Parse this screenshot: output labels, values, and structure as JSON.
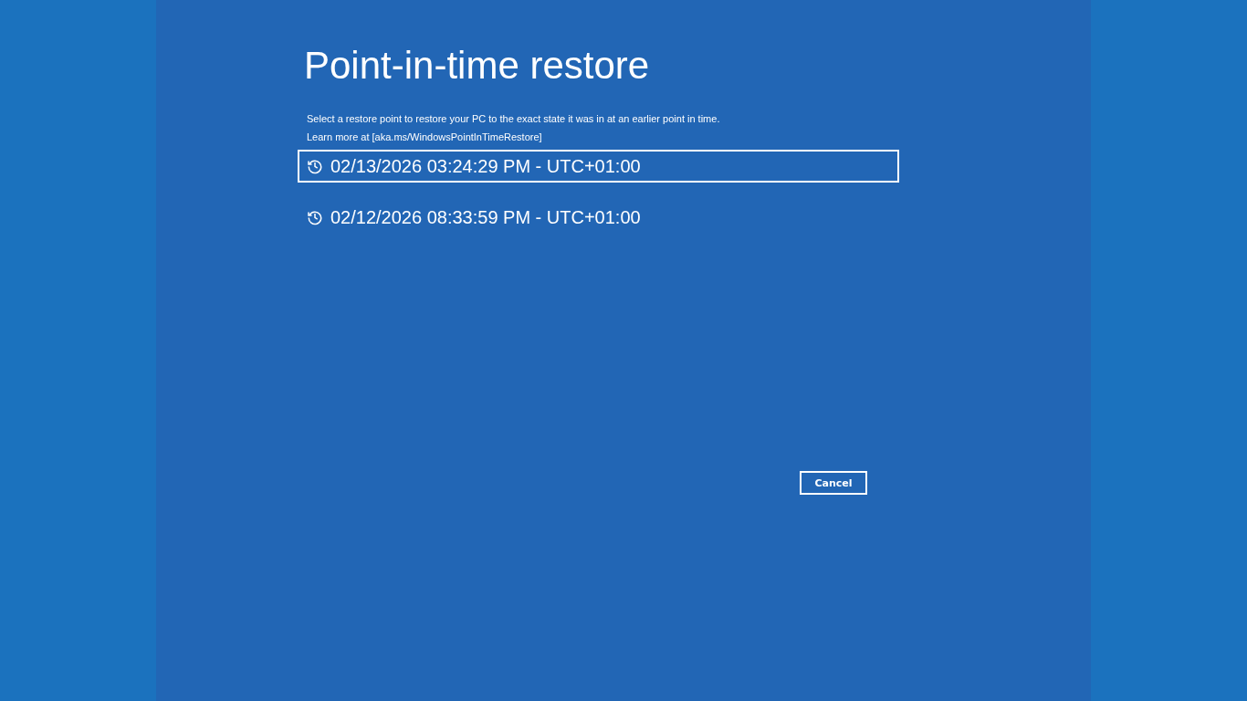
{
  "title": "Point-in-time restore",
  "description": "Select a restore point to restore your PC to the exact state it was in at an earlier point in time.",
  "learn_more": "Learn more at [aka.ms/WindowsPointInTimeRestore]",
  "restore_points": [
    {
      "label": "02/13/2026 03:24:29 PM - UTC+01:00",
      "selected": true
    },
    {
      "label": "02/12/2026 08:33:59 PM - UTC+01:00",
      "selected": false
    }
  ],
  "buttons": [
    "Cancel"
  ]
}
